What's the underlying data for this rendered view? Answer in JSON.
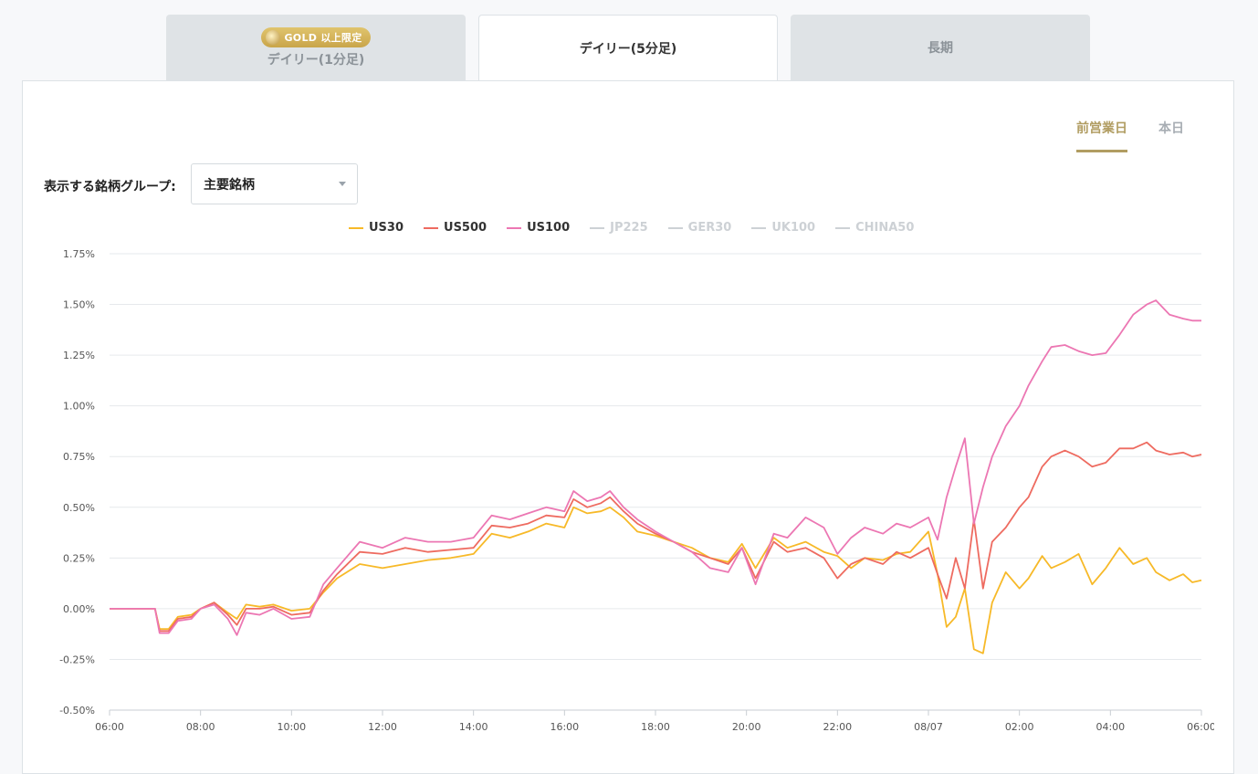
{
  "tabs": [
    {
      "label": "デイリー(1分足)",
      "badge": "GOLD 以上限定",
      "active": false
    },
    {
      "label": "デイリー(5分足)",
      "active": true
    },
    {
      "label": "長期",
      "active": false
    }
  ],
  "day_toggle": {
    "previous": "前営業日",
    "today": "本日"
  },
  "group_select": {
    "label": "表示する銘柄グループ:",
    "value": "主要銘柄"
  },
  "colors": {
    "US30": "#f7b928",
    "US500": "#ee6b60",
    "US100": "#ec77b3",
    "inactive": "#cdd1d5",
    "accent": "#b19d62"
  },
  "chart_data": {
    "type": "line",
    "title": "",
    "xlabel": "",
    "ylabel": "",
    "x_ticks": [
      "06:00",
      "08:00",
      "10:00",
      "12:00",
      "14:00",
      "16:00",
      "18:00",
      "20:00",
      "22:00",
      "08/07",
      "02:00",
      "04:00",
      "06:00"
    ],
    "y_ticks": [
      "1.75%",
      "1.50%",
      "1.25%",
      "1.00%",
      "0.75%",
      "0.50%",
      "0.25%",
      "0.00%",
      "-0.25%",
      "-0.50%"
    ],
    "ylim": [
      -0.5,
      1.75
    ],
    "x_unit": "hours since 06:00",
    "xlim": [
      0,
      24
    ],
    "legend": [
      {
        "name": "US30",
        "active": true
      },
      {
        "name": "US500",
        "active": true
      },
      {
        "name": "US100",
        "active": true
      },
      {
        "name": "JP225",
        "active": false
      },
      {
        "name": "GER30",
        "active": false
      },
      {
        "name": "UK100",
        "active": false
      },
      {
        "name": "CHINA50",
        "active": false
      }
    ],
    "series": [
      {
        "name": "US30",
        "points": [
          [
            0,
            0
          ],
          [
            1,
            0
          ],
          [
            1.1,
            -0.1
          ],
          [
            1.3,
            -0.1
          ],
          [
            1.5,
            -0.04
          ],
          [
            1.8,
            -0.03
          ],
          [
            2,
            0
          ],
          [
            2.3,
            0.03
          ],
          [
            2.6,
            -0.02
          ],
          [
            2.8,
            -0.05
          ],
          [
            3,
            0.02
          ],
          [
            3.3,
            0.01
          ],
          [
            3.6,
            0.02
          ],
          [
            4,
            -0.01
          ],
          [
            4.4,
            0
          ],
          [
            4.7,
            0.08
          ],
          [
            5,
            0.15
          ],
          [
            5.5,
            0.22
          ],
          [
            6,
            0.2
          ],
          [
            6.5,
            0.22
          ],
          [
            7,
            0.24
          ],
          [
            7.5,
            0.25
          ],
          [
            8,
            0.27
          ],
          [
            8.4,
            0.37
          ],
          [
            8.8,
            0.35
          ],
          [
            9.2,
            0.38
          ],
          [
            9.6,
            0.42
          ],
          [
            10,
            0.4
          ],
          [
            10.2,
            0.5
          ],
          [
            10.5,
            0.47
          ],
          [
            10.8,
            0.48
          ],
          [
            11,
            0.5
          ],
          [
            11.3,
            0.45
          ],
          [
            11.6,
            0.38
          ],
          [
            12,
            0.36
          ],
          [
            12.4,
            0.33
          ],
          [
            12.8,
            0.3
          ],
          [
            13.2,
            0.25
          ],
          [
            13.6,
            0.23
          ],
          [
            13.9,
            0.32
          ],
          [
            14.2,
            0.2
          ],
          [
            14.6,
            0.35
          ],
          [
            14.9,
            0.3
          ],
          [
            15.3,
            0.33
          ],
          [
            15.7,
            0.28
          ],
          [
            16,
            0.26
          ],
          [
            16.3,
            0.2
          ],
          [
            16.6,
            0.25
          ],
          [
            17,
            0.24
          ],
          [
            17.3,
            0.27
          ],
          [
            17.6,
            0.28
          ],
          [
            18,
            0.38
          ],
          [
            18.2,
            0.17
          ],
          [
            18.4,
            -0.09
          ],
          [
            18.6,
            -0.04
          ],
          [
            18.8,
            0.1
          ],
          [
            19,
            -0.2
          ],
          [
            19.2,
            -0.22
          ],
          [
            19.4,
            0.03
          ],
          [
            19.7,
            0.18
          ],
          [
            20,
            0.1
          ],
          [
            20.2,
            0.15
          ],
          [
            20.5,
            0.26
          ],
          [
            20.7,
            0.2
          ],
          [
            21,
            0.23
          ],
          [
            21.3,
            0.27
          ],
          [
            21.6,
            0.12
          ],
          [
            21.9,
            0.2
          ],
          [
            22.2,
            0.3
          ],
          [
            22.5,
            0.22
          ],
          [
            22.8,
            0.25
          ],
          [
            23,
            0.18
          ],
          [
            23.3,
            0.14
          ],
          [
            23.6,
            0.17
          ],
          [
            23.8,
            0.13
          ],
          [
            24,
            0.14
          ]
        ]
      },
      {
        "name": "US500",
        "points": [
          [
            0,
            0
          ],
          [
            1,
            0
          ],
          [
            1.1,
            -0.11
          ],
          [
            1.3,
            -0.11
          ],
          [
            1.5,
            -0.05
          ],
          [
            1.8,
            -0.04
          ],
          [
            2,
            0
          ],
          [
            2.3,
            0.03
          ],
          [
            2.6,
            -0.03
          ],
          [
            2.8,
            -0.08
          ],
          [
            3,
            0
          ],
          [
            3.3,
            0
          ],
          [
            3.6,
            0.01
          ],
          [
            4,
            -0.03
          ],
          [
            4.4,
            -0.02
          ],
          [
            4.7,
            0.09
          ],
          [
            5,
            0.17
          ],
          [
            5.5,
            0.28
          ],
          [
            6,
            0.27
          ],
          [
            6.5,
            0.3
          ],
          [
            7,
            0.28
          ],
          [
            7.5,
            0.29
          ],
          [
            8,
            0.3
          ],
          [
            8.4,
            0.41
          ],
          [
            8.8,
            0.4
          ],
          [
            9.2,
            0.42
          ],
          [
            9.6,
            0.46
          ],
          [
            10,
            0.45
          ],
          [
            10.2,
            0.54
          ],
          [
            10.5,
            0.5
          ],
          [
            10.8,
            0.52
          ],
          [
            11,
            0.55
          ],
          [
            11.3,
            0.48
          ],
          [
            11.6,
            0.42
          ],
          [
            12,
            0.37
          ],
          [
            12.4,
            0.33
          ],
          [
            12.8,
            0.28
          ],
          [
            13.2,
            0.25
          ],
          [
            13.6,
            0.22
          ],
          [
            13.9,
            0.3
          ],
          [
            14.2,
            0.15
          ],
          [
            14.6,
            0.33
          ],
          [
            14.9,
            0.28
          ],
          [
            15.3,
            0.3
          ],
          [
            15.7,
            0.25
          ],
          [
            16,
            0.15
          ],
          [
            16.3,
            0.22
          ],
          [
            16.6,
            0.25
          ],
          [
            17,
            0.22
          ],
          [
            17.3,
            0.28
          ],
          [
            17.6,
            0.25
          ],
          [
            18,
            0.3
          ],
          [
            18.2,
            0.17
          ],
          [
            18.4,
            0.05
          ],
          [
            18.6,
            0.25
          ],
          [
            18.8,
            0.1
          ],
          [
            19,
            0.44
          ],
          [
            19.2,
            0.1
          ],
          [
            19.4,
            0.33
          ],
          [
            19.7,
            0.4
          ],
          [
            20,
            0.5
          ],
          [
            20.2,
            0.55
          ],
          [
            20.5,
            0.7
          ],
          [
            20.7,
            0.75
          ],
          [
            21,
            0.78
          ],
          [
            21.3,
            0.75
          ],
          [
            21.6,
            0.7
          ],
          [
            21.9,
            0.72
          ],
          [
            22.2,
            0.79
          ],
          [
            22.5,
            0.79
          ],
          [
            22.8,
            0.82
          ],
          [
            23,
            0.78
          ],
          [
            23.3,
            0.76
          ],
          [
            23.6,
            0.77
          ],
          [
            23.8,
            0.75
          ],
          [
            24,
            0.76
          ]
        ]
      },
      {
        "name": "US100",
        "points": [
          [
            0,
            0
          ],
          [
            1,
            0
          ],
          [
            1.1,
            -0.12
          ],
          [
            1.3,
            -0.12
          ],
          [
            1.5,
            -0.06
          ],
          [
            1.8,
            -0.05
          ],
          [
            2,
            0
          ],
          [
            2.3,
            0.02
          ],
          [
            2.6,
            -0.05
          ],
          [
            2.8,
            -0.13
          ],
          [
            3,
            -0.02
          ],
          [
            3.3,
            -0.03
          ],
          [
            3.6,
            0
          ],
          [
            4,
            -0.05
          ],
          [
            4.4,
            -0.04
          ],
          [
            4.7,
            0.12
          ],
          [
            5,
            0.2
          ],
          [
            5.5,
            0.33
          ],
          [
            6,
            0.3
          ],
          [
            6.5,
            0.35
          ],
          [
            7,
            0.33
          ],
          [
            7.5,
            0.33
          ],
          [
            8,
            0.35
          ],
          [
            8.4,
            0.46
          ],
          [
            8.8,
            0.44
          ],
          [
            9.2,
            0.47
          ],
          [
            9.6,
            0.5
          ],
          [
            10,
            0.48
          ],
          [
            10.2,
            0.58
          ],
          [
            10.5,
            0.53
          ],
          [
            10.8,
            0.55
          ],
          [
            11,
            0.58
          ],
          [
            11.3,
            0.5
          ],
          [
            11.6,
            0.44
          ],
          [
            12,
            0.38
          ],
          [
            12.4,
            0.33
          ],
          [
            12.8,
            0.28
          ],
          [
            13.2,
            0.2
          ],
          [
            13.6,
            0.18
          ],
          [
            13.9,
            0.3
          ],
          [
            14.2,
            0.12
          ],
          [
            14.6,
            0.37
          ],
          [
            14.9,
            0.35
          ],
          [
            15.3,
            0.45
          ],
          [
            15.7,
            0.4
          ],
          [
            16,
            0.27
          ],
          [
            16.3,
            0.35
          ],
          [
            16.6,
            0.4
          ],
          [
            17,
            0.37
          ],
          [
            17.3,
            0.42
          ],
          [
            17.6,
            0.4
          ],
          [
            18,
            0.45
          ],
          [
            18.2,
            0.34
          ],
          [
            18.4,
            0.55
          ],
          [
            18.6,
            0.7
          ],
          [
            18.8,
            0.84
          ],
          [
            19,
            0.42
          ],
          [
            19.2,
            0.6
          ],
          [
            19.4,
            0.75
          ],
          [
            19.7,
            0.9
          ],
          [
            20,
            1.0
          ],
          [
            20.2,
            1.1
          ],
          [
            20.5,
            1.22
          ],
          [
            20.7,
            1.29
          ],
          [
            21,
            1.3
          ],
          [
            21.3,
            1.27
          ],
          [
            21.6,
            1.25
          ],
          [
            21.9,
            1.26
          ],
          [
            22.2,
            1.35
          ],
          [
            22.5,
            1.45
          ],
          [
            22.8,
            1.5
          ],
          [
            23,
            1.52
          ],
          [
            23.3,
            1.45
          ],
          [
            23.6,
            1.43
          ],
          [
            23.8,
            1.42
          ],
          [
            24,
            1.42
          ]
        ]
      }
    ]
  }
}
